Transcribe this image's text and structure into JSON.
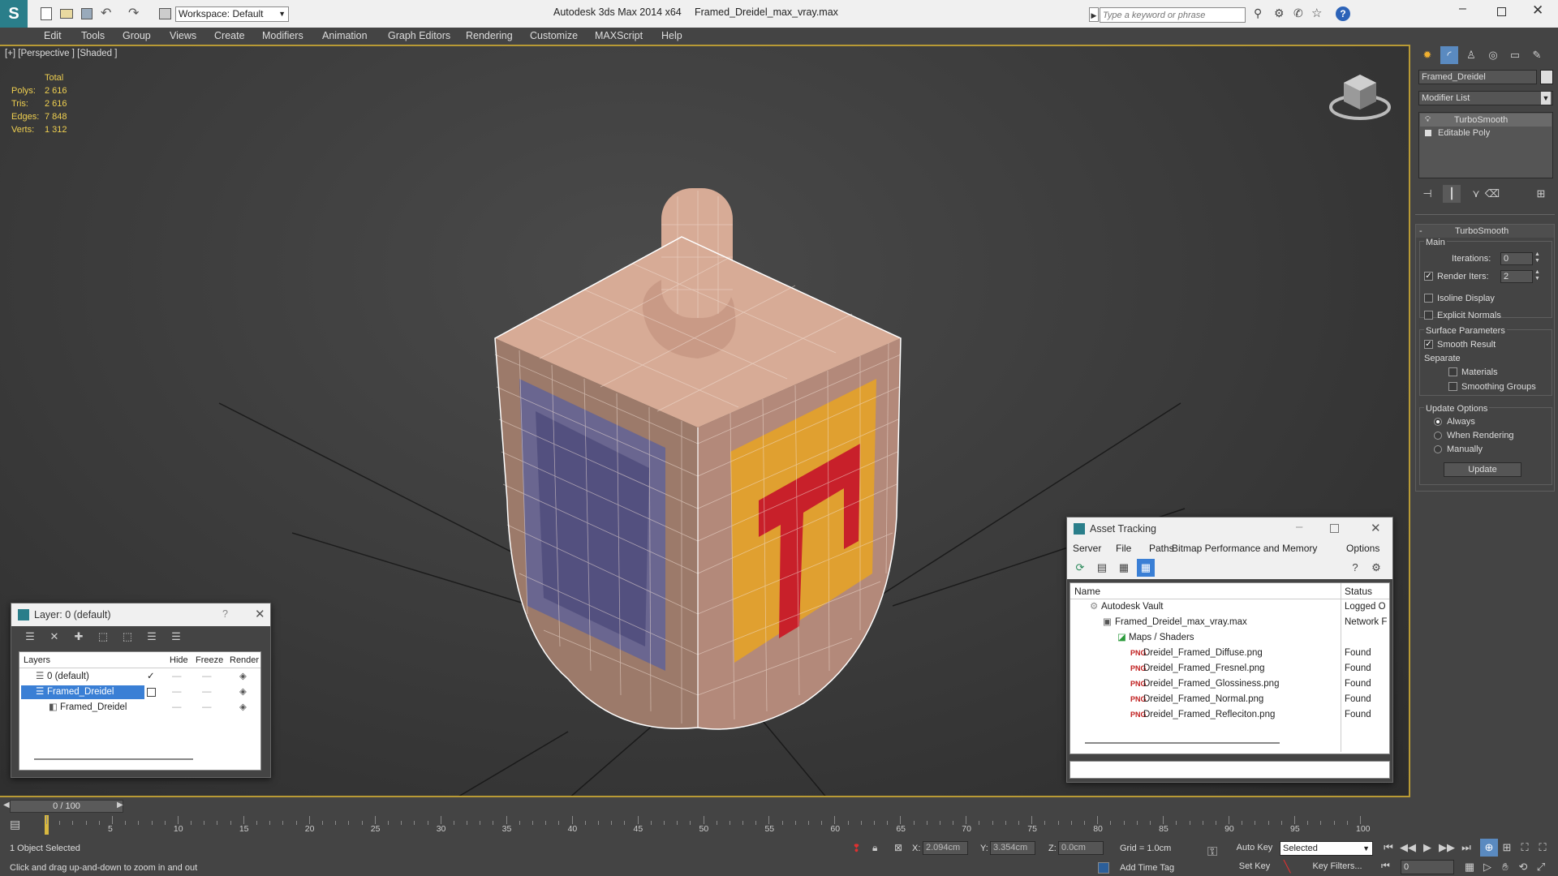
{
  "titlebar": {
    "app_title": "Autodesk 3ds Max  2014 x64",
    "file_name": "Framed_Dreidel_max_vray.max",
    "workspace": "Workspace: Default",
    "search_placeholder": "Type a keyword or phrase"
  },
  "menu": [
    "Edit",
    "Tools",
    "Group",
    "Views",
    "Create",
    "Modifiers",
    "Animation",
    "Graph Editors",
    "Rendering",
    "Customize",
    "MAXScript",
    "Help"
  ],
  "viewport": {
    "label": "[+] [Perspective ] [Shaded ]",
    "stats_header": "Total",
    "stats": [
      {
        "label": "Polys:",
        "value": "2 616"
      },
      {
        "label": "Tris:",
        "value": "2 616"
      },
      {
        "label": "Edges:",
        "value": "7 848"
      },
      {
        "label": "Verts:",
        "value": "1 312"
      }
    ]
  },
  "command_panel": {
    "object_name": "Framed_Dreidel",
    "modifier_list": "Modifier List",
    "stack": [
      "TurboSmooth",
      "Editable Poly"
    ],
    "rollout_title": "TurboSmooth",
    "main_label": "Main",
    "iterations_label": "Iterations:",
    "iterations_value": "0",
    "render_iters_label": "Render Iters:",
    "render_iters_value": "2",
    "isoline_label": "Isoline Display",
    "explicit_normals_label": "Explicit Normals",
    "surface_params_label": "Surface Parameters",
    "smooth_result_label": "Smooth Result",
    "separate_label": "Separate",
    "materials_label": "Materials",
    "smoothing_groups_label": "Smoothing Groups",
    "update_options_label": "Update Options",
    "always_label": "Always",
    "when_rendering_label": "When Rendering",
    "manually_label": "Manually",
    "update_button": "Update"
  },
  "layer_window": {
    "title": "Layer: 0 (default)",
    "help": "?",
    "columns": [
      "Layers",
      "Hide",
      "Freeze",
      "Render"
    ],
    "rows": [
      {
        "name": "0 (default)",
        "indent": 0
      },
      {
        "name": "Framed_Dreidel",
        "indent": 0
      },
      {
        "name": "Framed_Dreidel",
        "indent": 1
      }
    ]
  },
  "asset_window": {
    "title": "Asset Tracking",
    "menu": [
      "Server",
      "File",
      "Paths",
      "Bitmap Performance and Memory",
      "Options"
    ],
    "columns": [
      "Name",
      "Status"
    ],
    "rows": [
      {
        "name": "Autodesk Vault",
        "status": "Logged O",
        "indent": 1
      },
      {
        "name": "Framed_Dreidel_max_vray.max",
        "status": "Network F",
        "indent": 2
      },
      {
        "name": "Maps / Shaders",
        "status": "",
        "indent": 3
      },
      {
        "name": "Dreidel_Framed_Diffuse.png",
        "status": "Found",
        "indent": 4
      },
      {
        "name": "Dreidel_Framed_Fresnel.png",
        "status": "Found",
        "indent": 4
      },
      {
        "name": "Dreidel_Framed_Glossiness.png",
        "status": "Found",
        "indent": 4
      },
      {
        "name": "Dreidel_Framed_Normal.png",
        "status": "Found",
        "indent": 4
      },
      {
        "name": "Dreidel_Framed_Refleciton.png",
        "status": "Found",
        "indent": 4
      }
    ]
  },
  "timeline": {
    "frame_label": "0 / 100",
    "ticks": [
      5,
      10,
      15,
      20,
      25,
      30,
      35,
      40,
      45,
      50,
      55,
      60,
      65,
      70,
      75,
      80,
      85,
      90,
      95,
      100
    ]
  },
  "status": {
    "selection": "1 Object Selected",
    "prompt": "Click and drag up-and-down to zoom in and out",
    "x_label": "X:",
    "x_value": "2.094cm",
    "y_label": "Y:",
    "y_value": "3.354cm",
    "z_label": "Z:",
    "z_value": "0.0cm",
    "grid": "Grid = 1.0cm",
    "add_time_tag": "Add Time Tag",
    "auto_key": "Auto Key",
    "set_key": "Set Key",
    "selected_value": "Selected",
    "key_filters": "Key Filters...",
    "frame_value": "0"
  }
}
